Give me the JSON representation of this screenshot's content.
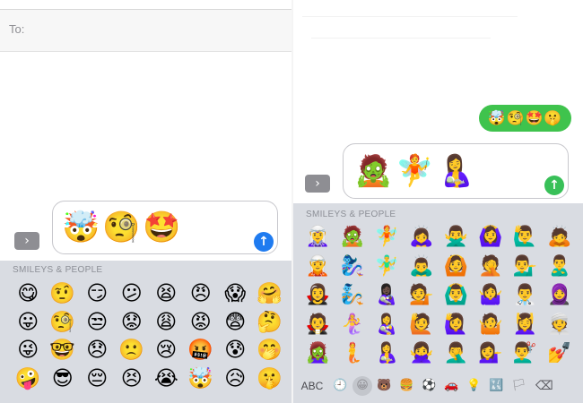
{
  "left": {
    "to_label": "To:",
    "compose_emojis": [
      "🤯",
      "🧐",
      "🤩"
    ],
    "keyboard_title": "SMILEYS & PEOPLE",
    "grid": [
      "😋",
      "🤨",
      "😏",
      "😕",
      "😫",
      "😠",
      "😱",
      "🤗",
      "😛",
      "🧐",
      "😒",
      "😟",
      "😩",
      "😡",
      "😨",
      "🤔",
      "😜",
      "🤓",
      "😞",
      "🙁",
      "😢",
      "🤬",
      "😰",
      "🤭",
      "🤪",
      "😎",
      "😔",
      "😣",
      "😭",
      "🤯",
      "😥",
      "🤫"
    ]
  },
  "right": {
    "sent_bubble": "🤯🧐🤩🤫",
    "compose_emojis": [
      "🧟",
      "🧚",
      "🤱"
    ],
    "keyboard_title": "SMILEYS & PEOPLE",
    "grid": [
      "🧝‍♀️",
      "🧟",
      "🧚",
      "🙇‍♀️",
      "🙅‍♂️",
      "🙆‍♀️",
      "🙋‍♂️",
      "🙇",
      "🧝",
      "🧞‍♀️",
      "🧚‍♂️",
      "🙇‍♂️",
      "🙆",
      "🤦",
      "💁‍♂️",
      "🙎‍♂️",
      "🧛‍♀️",
      "🧞",
      "👩🏿‍🍼",
      "💁",
      "🙆‍♂️",
      "🤷‍♀️",
      "👨‍⚕️",
      "🧕",
      "🧛",
      "🧜‍♀️",
      "👩‍🍼",
      "🙋",
      "🙋‍♀️",
      "🤷",
      "💆‍♀️",
      "👳",
      "🧟‍♀️",
      "🧜",
      "🤱",
      "🙅‍♀️",
      "🤦‍♂️",
      "💁‍♀️",
      "💇‍♂️",
      "💅"
    ],
    "categories": {
      "abc": "ABC",
      "icons": [
        "🕘",
        "😀",
        "🐻",
        "🍔",
        "⚽",
        "🚗",
        "💡",
        "🔣",
        "🏳"
      ],
      "delete": "⌫"
    }
  },
  "colors": {
    "send_blue": "#1f7bf0",
    "send_green": "#38c058",
    "bubble_green": "#3fc34d",
    "keyboard_bg": "#d9dce2"
  },
  "icons": {
    "expand": "chevron-right-icon",
    "send": "arrow-up-icon",
    "delete": "backspace-icon"
  }
}
